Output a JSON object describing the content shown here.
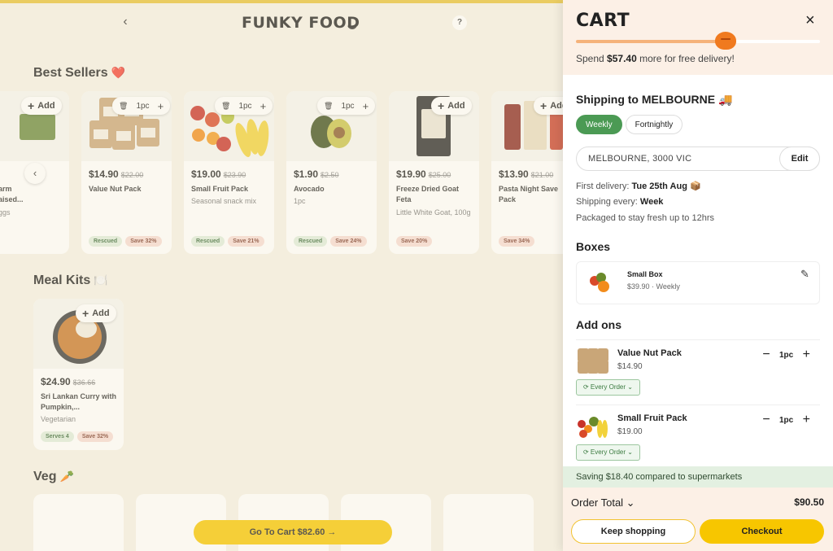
{
  "header": {
    "brand": "FUNKY FOOD",
    "back_icon": "‹",
    "help_icon": "?"
  },
  "sections": {
    "best_sellers": "Best Sellers",
    "best_sellers_emoji": "❤️",
    "meal_kits": "Meal Kits",
    "meal_kits_emoji": "🍽️",
    "veg": "Veg",
    "veg_emoji": "🥕"
  },
  "best_sellers": [
    {
      "name": "arm\naised...",
      "sub": "ggs",
      "action": "Add"
    },
    {
      "price": "$14.90",
      "old_price": "$22.00",
      "name": "Value Nut Pack",
      "qty": "1pc",
      "tags": [
        "Rescued",
        "Save 32%"
      ]
    },
    {
      "price": "$19.00",
      "old_price": "$23.90",
      "name": "Small Fruit Pack",
      "sub": "Seasonal snack mix",
      "qty": "1pc",
      "tags": [
        "Rescued",
        "Save 21%"
      ]
    },
    {
      "price": "$1.90",
      "old_price": "$2.50",
      "name": "Avocado",
      "sub": "1pc",
      "qty": "1pc",
      "tags": [
        "Rescued",
        "Save 24%"
      ]
    },
    {
      "price": "$19.90",
      "old_price": "$25.00",
      "name": "Freeze Dried Goat Feta",
      "sub": "Little White Goat, 100g",
      "action": "Add",
      "tags": [
        "Save 20%"
      ]
    },
    {
      "price": "$13.90",
      "old_price": "$21.00",
      "name": "Pasta Night Save Pack",
      "action": "Add",
      "tags": [
        "Save 34%"
      ]
    }
  ],
  "meal_kit": {
    "price": "$24.90",
    "old_price": "$36.66",
    "name": "Sri Lankan Curry with Pumpkin,...",
    "sub": "Vegetarian",
    "action": "Add",
    "tags": [
      "Serves 4",
      "Save 32%"
    ]
  },
  "go_to_cart": "Go To Cart $82.60 →",
  "cart": {
    "title": "CART",
    "close_icon": "×",
    "progress": 0.62,
    "free_delivery_prefix": "Spend ",
    "free_delivery_amount": "$57.40",
    "free_delivery_suffix": " more for free delivery!",
    "shipping_title": "Shipping to MELBOURNE 🚚",
    "frequency_options": [
      "Weekly",
      "Fortnightly"
    ],
    "frequency_selected": "Weekly",
    "address": "MELBOURNE, 3000 VIC",
    "edit_label": "Edit",
    "first_delivery_label": "First delivery: ",
    "first_delivery_value": "Tue 25th Aug 📦",
    "shipping_every_label": "Shipping every: ",
    "shipping_every_value": "Week",
    "packaged_note": "Packaged to stay fresh up to 12hrs",
    "boxes_title": "Boxes",
    "box": {
      "name": "Small Box",
      "meta": "$39.90 · Weekly"
    },
    "addons_title": "Add ons",
    "addons": [
      {
        "name": "Value Nut Pack",
        "price": "$14.90",
        "qty": "1pc",
        "schedule": "⟳ Every Order ⌄"
      },
      {
        "name": "Small Fruit Pack",
        "price": "$19.00",
        "qty": "1pc",
        "schedule": "⟳ Every Order ⌄"
      }
    ],
    "saving": "Saving $18.40 compared to supermarkets",
    "order_total_label": "Order Total ⌄",
    "order_total_value": "$90.50",
    "keep_shopping": "Keep shopping",
    "checkout": "Checkout"
  },
  "colors": {
    "brand_yellow": "#f7c600",
    "accent_green": "#4b9a54",
    "cart_header_bg": "#fcf0e6",
    "mascot_orange": "#f07a1f"
  }
}
